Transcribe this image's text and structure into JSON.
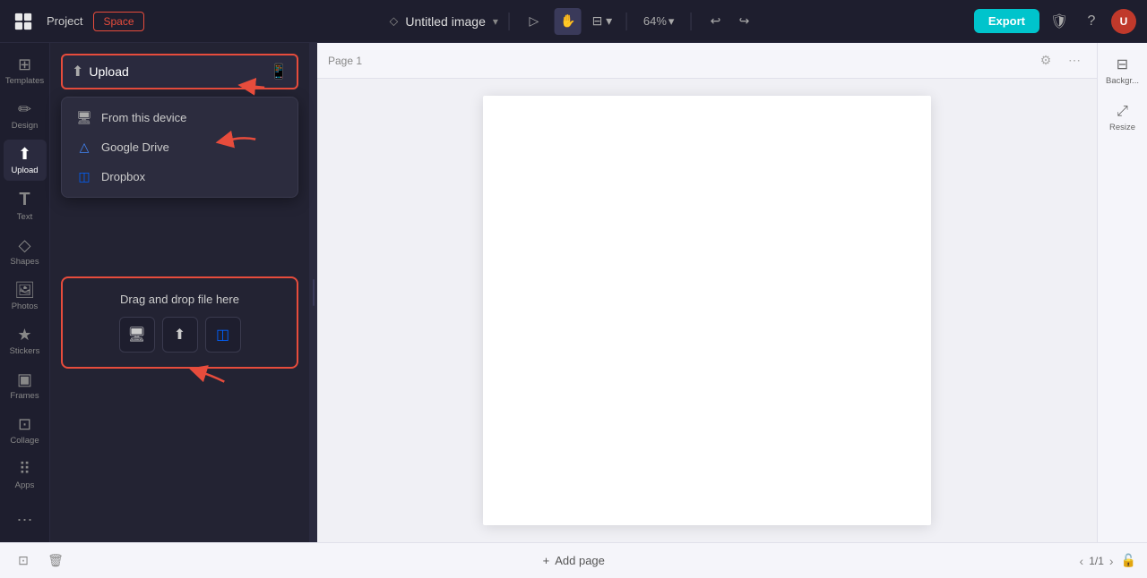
{
  "topbar": {
    "project_label": "Project",
    "space_label": "Space",
    "doc_title": "Untitled image",
    "export_label": "Export",
    "zoom_level": "64%"
  },
  "sidebar": {
    "items": [
      {
        "id": "templates",
        "label": "Templates",
        "icon": "⊞"
      },
      {
        "id": "design",
        "label": "Design",
        "icon": "✏️"
      },
      {
        "id": "upload",
        "label": "Upload",
        "icon": "⬆"
      },
      {
        "id": "text",
        "label": "Text",
        "icon": "T"
      },
      {
        "id": "shapes",
        "label": "Shapes",
        "icon": "◇"
      },
      {
        "id": "photos",
        "label": "Photos",
        "icon": "🖼"
      },
      {
        "id": "stickers",
        "label": "Stickers",
        "icon": "★"
      },
      {
        "id": "frames",
        "label": "Frames",
        "icon": "▣"
      },
      {
        "id": "collage",
        "label": "Collage",
        "icon": "⊡"
      },
      {
        "id": "apps",
        "label": "Apps",
        "icon": "⠿"
      }
    ]
  },
  "upload_panel": {
    "upload_button_label": "Upload",
    "phone_icon": "📱",
    "dropdown": {
      "items": [
        {
          "id": "device",
          "label": "From this device",
          "icon": "🖥"
        },
        {
          "id": "gdrive",
          "label": "Google Drive",
          "icon": "△"
        },
        {
          "id": "dropbox",
          "label": "Dropbox",
          "icon": "◫"
        }
      ]
    },
    "drag_drop": {
      "label": "Drag and drop file here",
      "icons": [
        {
          "id": "screen",
          "symbol": "🖥"
        },
        {
          "id": "upload",
          "symbol": "⬆"
        },
        {
          "id": "dropbox",
          "symbol": "◫"
        }
      ]
    }
  },
  "canvas": {
    "page_label": "Page 1"
  },
  "right_panel": {
    "items": [
      {
        "id": "background",
        "label": "Backgr..."
      },
      {
        "id": "resize",
        "label": "Resize"
      }
    ]
  },
  "bottom_bar": {
    "add_page_label": "Add page",
    "page_indicator": "1/1"
  }
}
